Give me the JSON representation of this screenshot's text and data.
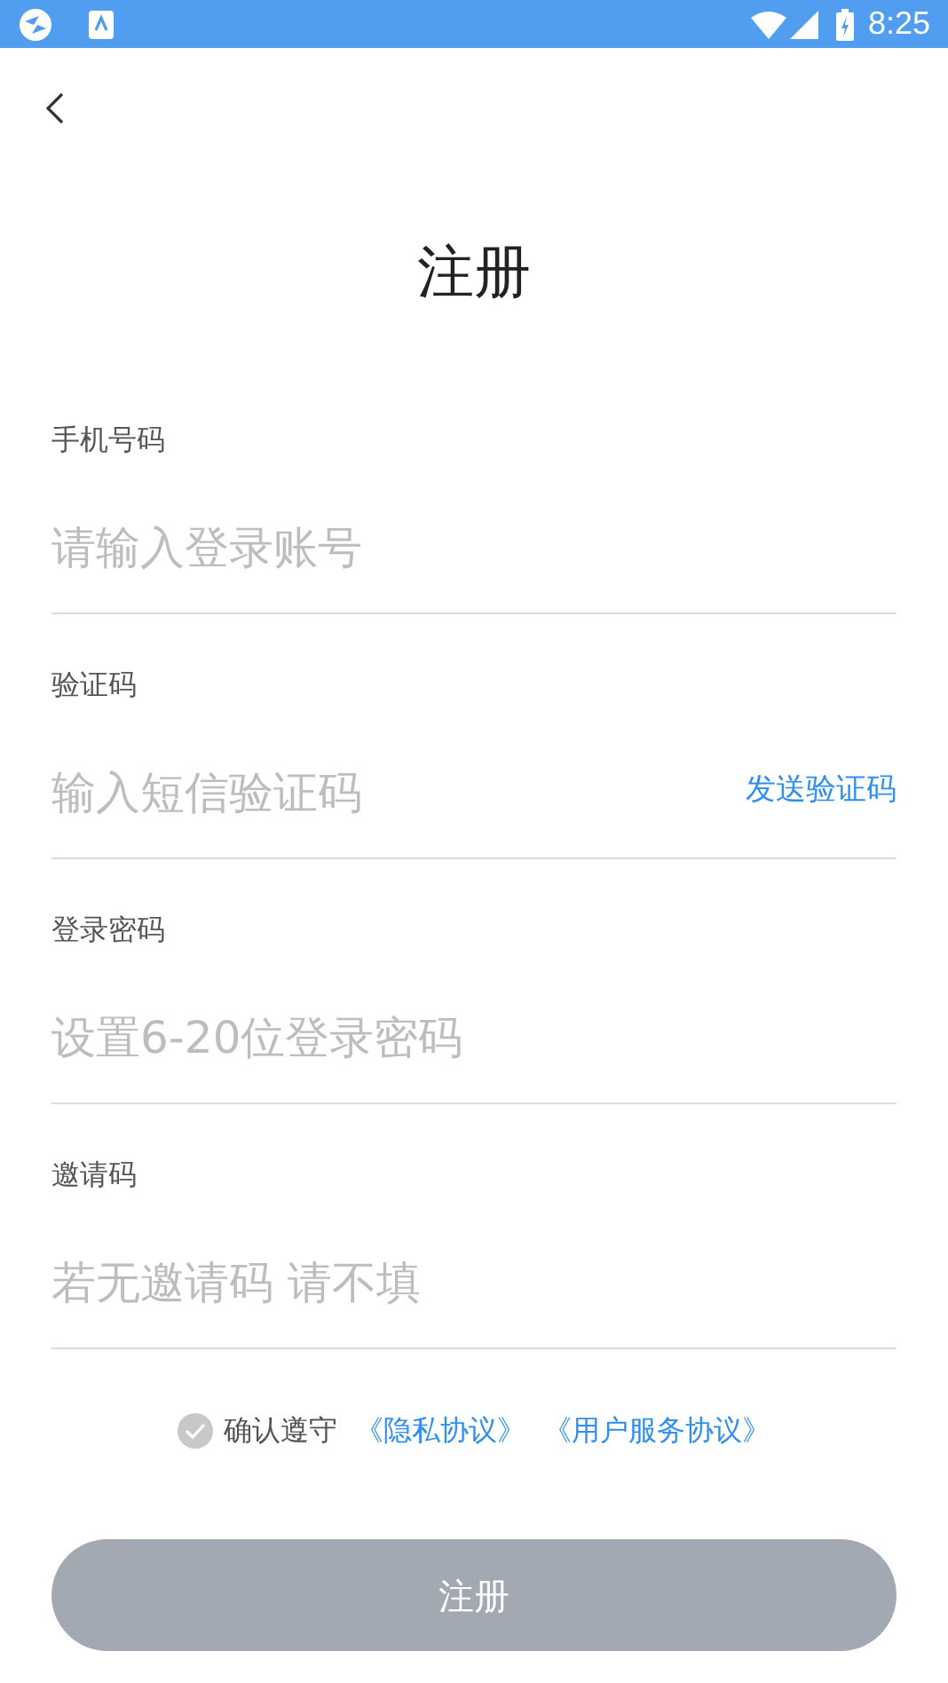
{
  "status_bar": {
    "time": "8:25"
  },
  "title": "注册",
  "fields": [
    {
      "kind": "text",
      "label": "手机号码",
      "placeholder": "请输入登录账号"
    },
    {
      "kind": "code",
      "label": "验证码",
      "placeholder": "输入短信验证码",
      "action": "发送验证码"
    },
    {
      "kind": "text",
      "label": "登录密码",
      "placeholder": "设置6-20位登录密码"
    },
    {
      "kind": "text",
      "label": "邀请码",
      "placeholder": "若无邀请码 请不填"
    }
  ],
  "agreement": {
    "checked": false,
    "text": "确认遵守",
    "links": [
      "《隐私协议》",
      "《用户服务协议》"
    ]
  },
  "submit": {
    "label": "注册",
    "disabled": true
  }
}
